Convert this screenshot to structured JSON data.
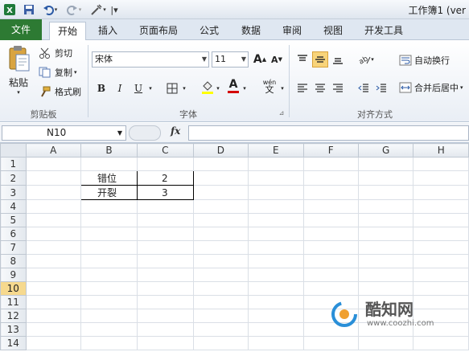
{
  "window": {
    "title": "工作簿1 (ver"
  },
  "tabs": [
    "文件",
    "开始",
    "插入",
    "页面布局",
    "公式",
    "数据",
    "审阅",
    "视图",
    "开发工具"
  ],
  "ribbon": {
    "clipboard": {
      "paste": "粘贴",
      "cut": "剪切",
      "copy": "复制",
      "format_painter": "格式刷",
      "group": "剪贴板"
    },
    "font": {
      "name": "宋体",
      "size": "11",
      "group": "字体",
      "bold": "B",
      "italic": "I",
      "underline": "U",
      "grow": "A",
      "shrink": "A",
      "font_color_letter": "A",
      "phonetic": "wén"
    },
    "alignment": {
      "wrap": "自动换行",
      "merge": "合并后居中",
      "group": "对齐方式"
    }
  },
  "formula": {
    "namebox": "N10",
    "fx": "fx",
    "value": ""
  },
  "sheet": {
    "columns": [
      "A",
      "B",
      "C",
      "D",
      "E",
      "F",
      "G",
      "H"
    ],
    "rows": [
      "1",
      "2",
      "3",
      "4",
      "5",
      "6",
      "7",
      "8",
      "9",
      "10",
      "11",
      "12",
      "13",
      "14"
    ],
    "selected_row": "10",
    "cells": {
      "B2": "错位",
      "C2": "2",
      "B3": "开裂",
      "C3": "3"
    }
  },
  "watermark": {
    "brand": "酷知网",
    "url": "www.coozhi.com"
  },
  "colors": {
    "file_tab": "#2d7a33",
    "selected_row": "#f6d98e",
    "font_color_bar": "#d40000",
    "fill_bar": "#ffff00"
  }
}
